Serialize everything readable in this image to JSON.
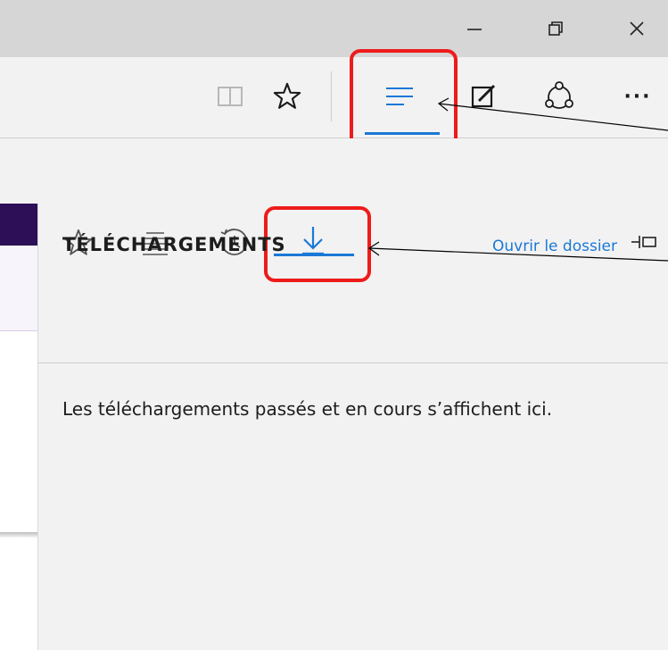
{
  "window": {
    "minimize_icon": "minimize-icon",
    "restore_icon": "restore-icon",
    "close_icon": "close-icon"
  },
  "toolbar": {
    "icons": [
      "reading-view-icon",
      "favorites-star-icon",
      "hub-icon",
      "web-note-icon",
      "share-icon",
      "more-icon"
    ],
    "more_label": "···"
  },
  "hub": {
    "tabs": [
      "favorites",
      "reading-list",
      "history",
      "downloads"
    ],
    "active_tab": "downloads",
    "title": "TÉLÉCHARGEMENTS",
    "open_folder_link": "Ouvrir le dossier",
    "empty_message": "Les téléchargements passés et en cours s’affichent ici."
  },
  "colors": {
    "accent": "#1a78d6",
    "highlight_box": "#ee1b1b",
    "titlebar": "#d6d6d6",
    "panel": "#f2f2f2",
    "page_header": "#2d0f57"
  }
}
